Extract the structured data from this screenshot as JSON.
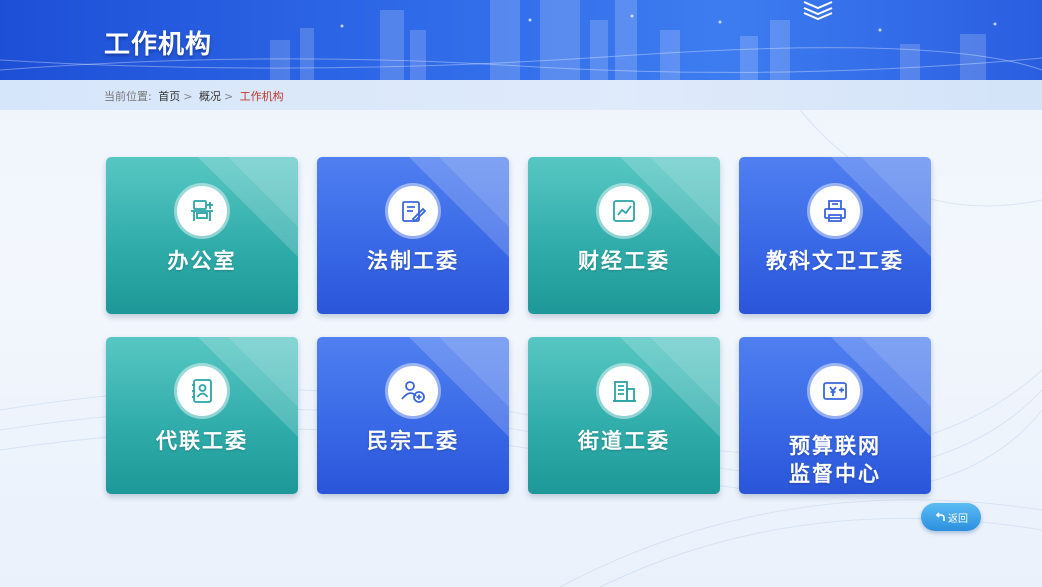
{
  "header": {
    "title": "工作机构"
  },
  "breadcrumb": {
    "label": "当前位置:",
    "items": [
      "首页",
      "概况"
    ],
    "separator": ">",
    "current": "工作机构"
  },
  "cards": [
    {
      "label": "办公室",
      "icon": "office-desk-icon",
      "theme": "teal"
    },
    {
      "label": "法制工委",
      "icon": "legal-document-icon",
      "theme": "blue"
    },
    {
      "label": "财经工委",
      "icon": "finance-chart-icon",
      "theme": "teal"
    },
    {
      "label": "教科文卫工委",
      "icon": "education-printer-icon",
      "theme": "blue"
    },
    {
      "label": "代联工委",
      "icon": "representative-contact-icon",
      "theme": "teal"
    },
    {
      "label": "民宗工委",
      "icon": "people-add-icon",
      "theme": "blue"
    },
    {
      "label": "街道工委",
      "icon": "street-building-icon",
      "theme": "teal"
    },
    {
      "label": "预算联网监督中心",
      "lines": [
        "预算联网",
        "监督中心"
      ],
      "icon": "budget-yen-icon",
      "theme": "blue"
    }
  ],
  "back_button": {
    "label": "返回",
    "icon": "return-arrow-icon"
  },
  "colors": {
    "header_blue": "#2f6ae8",
    "card_teal": "#2eaba9",
    "card_blue": "#3867e6",
    "breadcrumb_current": "#c0392b"
  }
}
